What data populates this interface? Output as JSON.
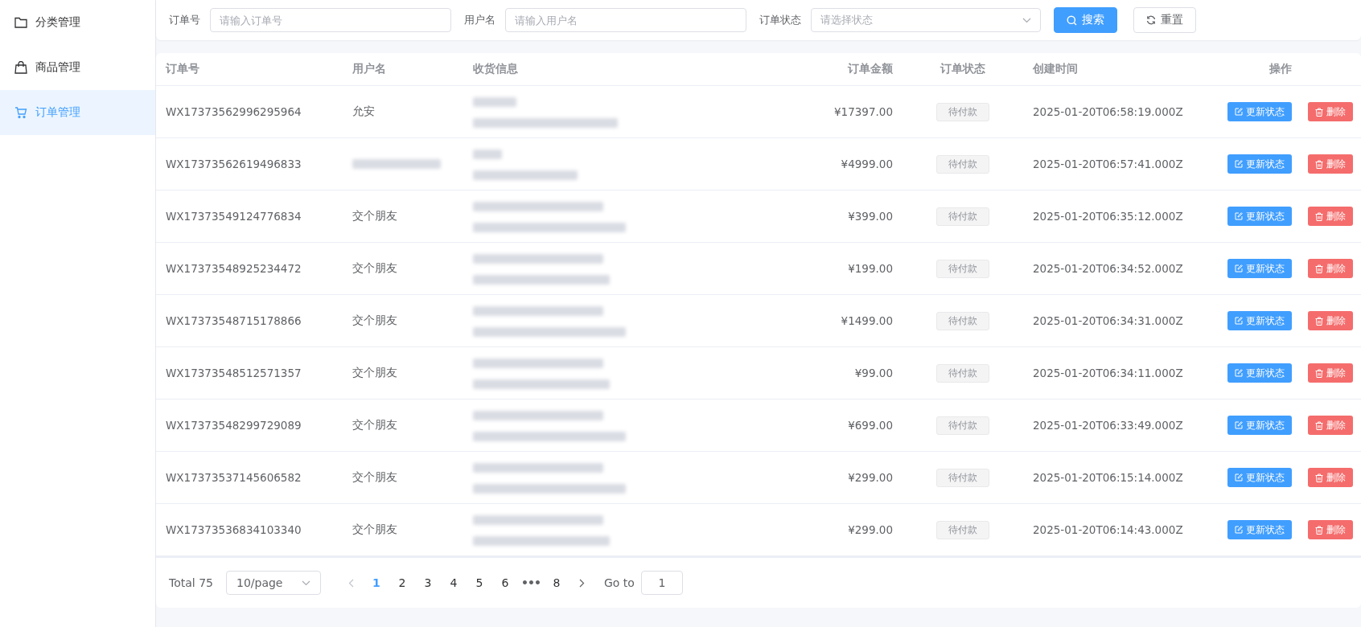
{
  "sidebar": {
    "items": [
      {
        "label": "分类管理",
        "selected": false
      },
      {
        "label": "商品管理",
        "selected": false
      },
      {
        "label": "订单管理",
        "selected": true
      }
    ]
  },
  "filters": {
    "fields": [
      {
        "label": "订单号",
        "kind": "input",
        "placeholder": "请输入订单号"
      },
      {
        "label": "用户名",
        "kind": "input",
        "placeholder": "请输入用户名"
      },
      {
        "label": "订单状态",
        "kind": "select",
        "placeholder": "请选择状态"
      }
    ],
    "search_button": "搜索",
    "reset_button": "重置"
  },
  "table": {
    "columns": [
      "订单号",
      "用户名",
      "收货信息",
      "订单金额",
      "订单状态",
      "创建时间",
      "操作"
    ],
    "rows": [
      {
        "order_no": "WX17373562996295964",
        "user": "允安",
        "user_redacted": false,
        "amount": "¥17397.00",
        "status": "待付款",
        "created": "2025-01-20T06:58:19.000Z",
        "update_button": "更新状态",
        "delete_button": "删除"
      },
      {
        "order_no": "WX17373562619496833",
        "user_redacted": true,
        "amount": "¥4999.00",
        "status": "待付款",
        "created": "2025-01-20T06:57:41.000Z",
        "update_button": "更新状态",
        "delete_button": "删除"
      },
      {
        "order_no": "WX17373549124776834",
        "user": "交个朋友",
        "user_redacted": false,
        "amount": "¥399.00",
        "status": "待付款",
        "created": "2025-01-20T06:35:12.000Z",
        "update_button": "更新状态",
        "delete_button": "删除"
      },
      {
        "order_no": "WX17373548925234472",
        "user": "交个朋友",
        "user_redacted": false,
        "amount": "¥199.00",
        "status": "待付款",
        "created": "2025-01-20T06:34:52.000Z",
        "update_button": "更新状态",
        "delete_button": "删除"
      },
      {
        "order_no": "WX17373548715178866",
        "user": "交个朋友",
        "user_redacted": false,
        "amount": "¥1499.00",
        "status": "待付款",
        "created": "2025-01-20T06:34:31.000Z",
        "update_button": "更新状态",
        "delete_button": "删除"
      },
      {
        "order_no": "WX17373548512571357",
        "user": "交个朋友",
        "user_redacted": false,
        "amount": "¥99.00",
        "status": "待付款",
        "created": "2025-01-20T06:34:11.000Z",
        "update_button": "更新状态",
        "delete_button": "删除"
      },
      {
        "order_no": "WX17373548299729089",
        "user": "交个朋友",
        "user_redacted": false,
        "amount": "¥699.00",
        "status": "待付款",
        "created": "2025-01-20T06:33:49.000Z",
        "update_button": "更新状态",
        "delete_button": "删除"
      },
      {
        "order_no": "WX17373537145606582",
        "user": "交个朋友",
        "user_redacted": false,
        "amount": "¥299.00",
        "status": "待付款",
        "created": "2025-01-20T06:15:14.000Z",
        "update_button": "更新状态",
        "delete_button": "删除"
      },
      {
        "order_no": "WX17373536834103340",
        "user": "交个朋友",
        "user_redacted": false,
        "amount": "¥299.00",
        "status": "待付款",
        "created": "2025-01-20T06:14:43.000Z",
        "update_button": "更新状态",
        "delete_button": "删除"
      }
    ]
  },
  "pagination": {
    "total": "Total 75",
    "page_size": "10/page",
    "pages": [
      {
        "label": "1",
        "kind": "page",
        "selected": true
      },
      {
        "label": "2",
        "kind": "page",
        "selected": false
      },
      {
        "label": "3",
        "kind": "page",
        "selected": false
      },
      {
        "label": "4",
        "kind": "page",
        "selected": false
      },
      {
        "label": "5",
        "kind": "page",
        "selected": false
      },
      {
        "label": "6",
        "kind": "page",
        "selected": false
      },
      {
        "label": "•••",
        "kind": "more",
        "selected": false
      },
      {
        "label": "8",
        "kind": "page",
        "selected": false
      }
    ],
    "goto_label": "Go to",
    "goto_value": "1"
  }
}
